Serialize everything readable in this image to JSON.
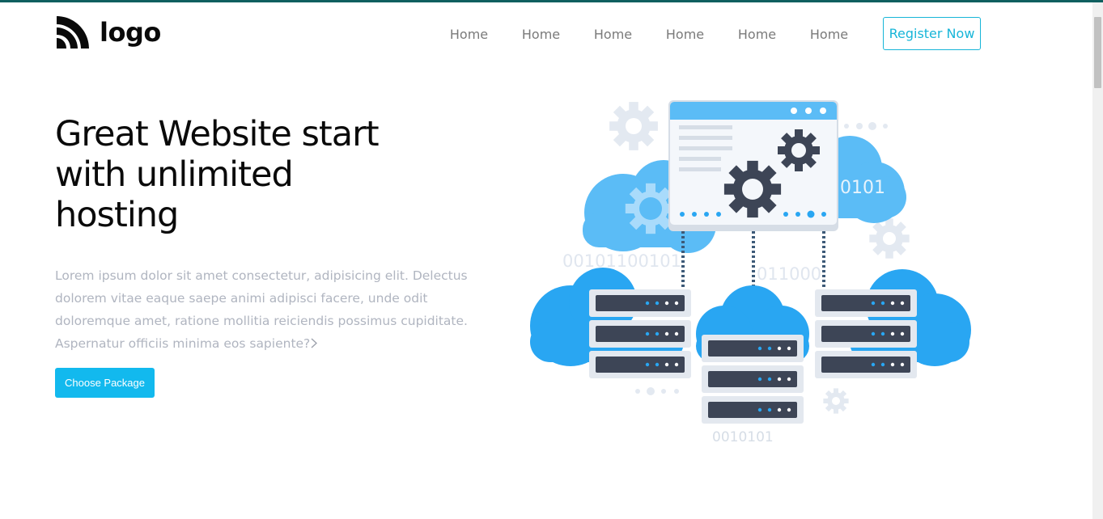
{
  "header": {
    "logo_text": "logo",
    "nav": [
      "Home",
      "Home",
      "Home",
      "Home",
      "Home",
      "Home"
    ],
    "register_label": "Register Now"
  },
  "hero": {
    "title": "Great Website start with unlimited hosting",
    "description": "Lorem ipsum dolor sit amet consectetur, adipisicing elit. Delectus dolorem vitae eaque saepe animi adipisci facere, unde odit doloremque amet, ratione mollitia reiciendis possimus cupiditate. Aspernatur officiis minima eos sapiente?",
    "cta_label": "Choose Package"
  },
  "illustration": {
    "binary_1": "0101",
    "binary_2": "00101100101",
    "binary_3": "011000",
    "binary_4": "0010101"
  },
  "colors": {
    "accent": "#17b5d8",
    "cta_bg": "#12b9ee",
    "top_border": "#0f5f5f",
    "cloud": "#29a6f2",
    "server": "#3d4556"
  }
}
